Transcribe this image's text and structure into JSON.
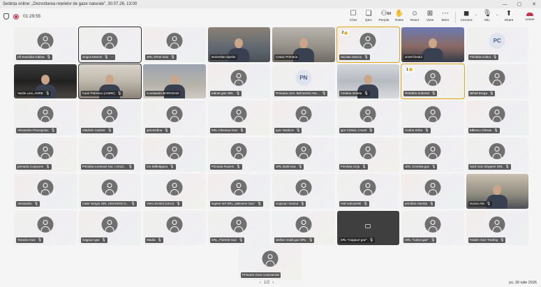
{
  "window": {
    "title": "Ședința online: „Dezvoltarea rețelelor de gaze naturale”, 30.07.26, 13:00",
    "minimize": "—",
    "restore": "▢",
    "close": "✕"
  },
  "toolbar": {
    "timer": "01:29:55",
    "chat": "Chat",
    "qa": "Q&A",
    "people": "People",
    "people_count": "64",
    "raise": "Raise",
    "react": "React",
    "view": "View",
    "more": "More",
    "camera": "Camera",
    "mic": "Mic",
    "share": "Share",
    "leave": "Leave"
  },
  "mic_glyph": "🎙",
  "participants": [
    "ufl Sandulia Galina",
    "Grigca Marcel",
    "SRL Orhei-Gaz",
    "temerelan sipelor",
    "Cesac Primaria",
    "Nicolae Danciu",
    "viorel fondul",
    "Primăria Cahul",
    "Vasile Lesi, ANRE",
    "Aurel Petrescu (ANRE)",
    "Constantin BOROSAN",
    "Edinet-gaz SRL",
    "Primaria com. Bolnoerini Ase...",
    "Cristina Violeta",
    "Primăria Zubresti",
    "Mihail Brega",
    "Alexandru Procopciuc",
    "Vladimir Cazimir",
    "gimotzdina",
    "SRL Chisinau-Gaz",
    "Igor Vasilcov",
    "Igor Cristal, CALM",
    "Andria Sirbu",
    "Bălescu Olessa",
    "primaria Copaceni",
    "Primăria Lentrovii Noi, r.Orod...",
    "Ion Mălnăgaza",
    "Primaria Razeni",
    "SRL Balti-Gaz",
    "Primăria Cirja",
    "SRL Cimislia-gaz",
    "Nord Gaz Singerei SRL",
    "Alexandru",
    "Cater Sergiu SRL UNGHENI G...",
    "Vieru Dmitrii (UUU)",
    "Inginer sef SRL „Iaboveni Gaz”",
    "Cojocan Viorica",
    "ANI Vulcanesti",
    "primăria Varnița",
    "Guzun Ala",
    "Taraclia-Gaz",
    "Gagauz-gaz",
    "Madia",
    "SRL_Floresti-Gaz",
    "Ștefan Vodă gaz SRL",
    "SRL \"Gagauz-gaz\"",
    "SRL \"Cahul gaz\"",
    "Rotalin Gaz Trading"
  ],
  "last_participant": "Primaria Gura Caienarului",
  "badges": {
    "nicolae": "2",
    "zubresti": "1",
    "cahul_initials": "PC",
    "bolnoerini_initials": "PN"
  },
  "pager": {
    "prev": "‹",
    "label": "1/2",
    "next": "›"
  },
  "datetime": "joi, 30 iulie 2026"
}
